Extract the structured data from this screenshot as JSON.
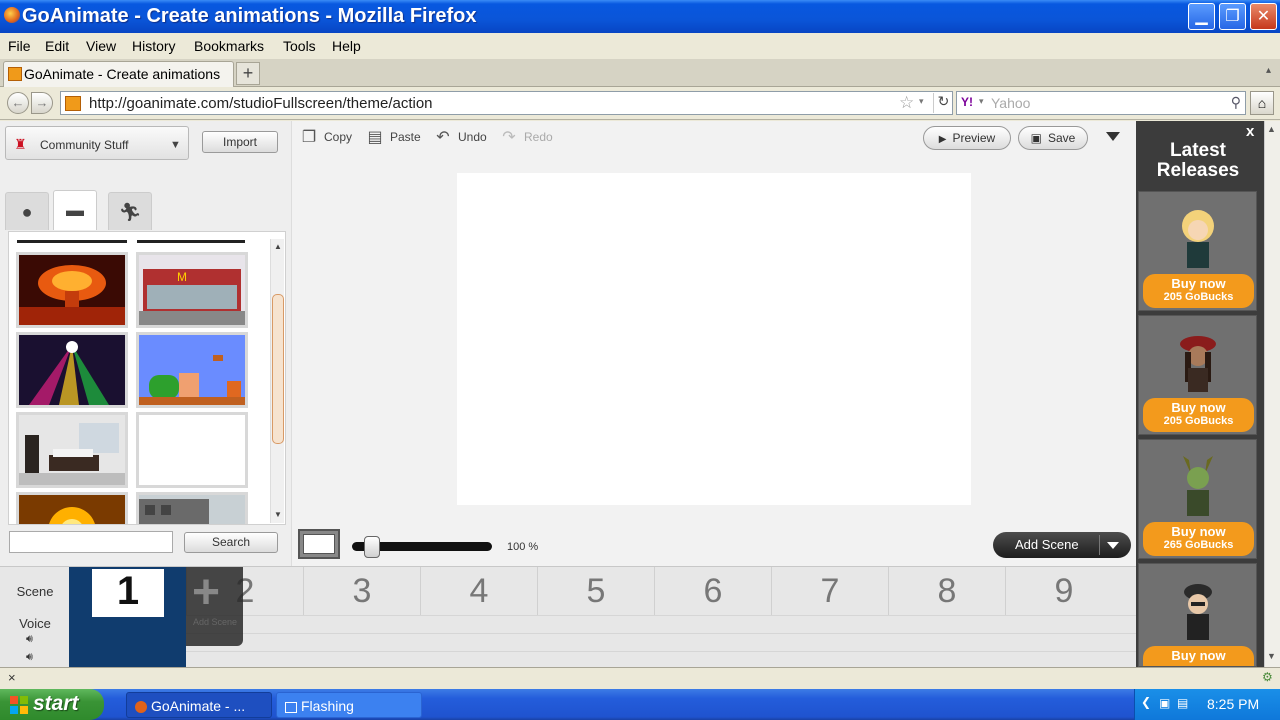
{
  "window": {
    "title": "GoAnimate - Create animations - Mozilla Firefox"
  },
  "menu": [
    "File",
    "Edit",
    "View",
    "History",
    "Bookmarks",
    "Tools",
    "Help"
  ],
  "tab": {
    "label": "GoAnimate - Create animations",
    "new_tab": "+"
  },
  "nav": {
    "url": "http://goanimate.com/studioFullscreen/theme/action",
    "search_placeholder": "Yahoo",
    "search_engine": "Y!"
  },
  "left": {
    "dropdown": "Community Stuff",
    "import": "Import",
    "search_button": "Search",
    "search_value": "",
    "tabs": [
      "props-icon",
      "backgrounds-icon",
      "characters-icon"
    ],
    "active_tab": 1
  },
  "toolbar": {
    "copy": "Copy",
    "paste": "Paste",
    "undo": "Undo",
    "redo": "Redo",
    "preview": "Preview",
    "save": "Save"
  },
  "zoom": {
    "label": "100 %",
    "level": 0.1
  },
  "add_scene": "Add Scene",
  "timeline": {
    "scene_label": "Scene",
    "voice_label": "Voice",
    "active_scene": "1",
    "add_scene_plus": "+",
    "add_scene_text": "Add Scene",
    "scene_numbers": [
      "2",
      "3",
      "4",
      "5",
      "6",
      "7",
      "8",
      "9"
    ]
  },
  "ads": {
    "title": "Latest Releases",
    "close": "x",
    "items": [
      {
        "buy": "Buy now",
        "price": "205 GoBucks"
      },
      {
        "buy": "Buy now",
        "price": "205 GoBucks"
      },
      {
        "buy": "Buy now",
        "price": "265 GoBucks"
      },
      {
        "buy": "Buy now",
        "price": ""
      }
    ]
  },
  "taskbar": {
    "start": "start",
    "tasks": [
      "GoAnimate - ...",
      "Flashing"
    ],
    "time": "8:25 PM"
  },
  "colors": {
    "titlebar": "#0a55d8",
    "accent_orange": "#f39a1c",
    "timeline_active": "#103c6e"
  }
}
